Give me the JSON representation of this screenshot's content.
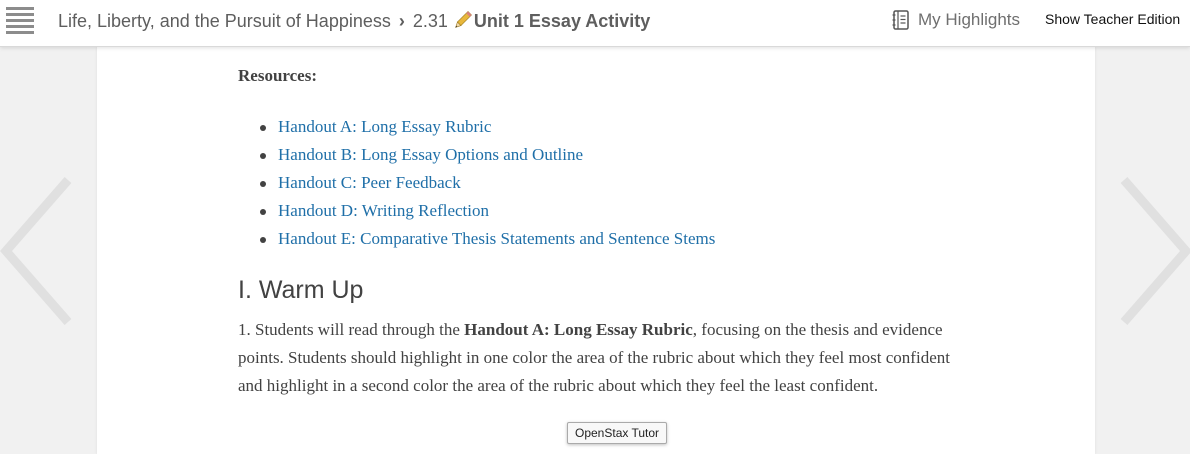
{
  "header": {
    "menu_icon": "hamburger-menu-icon",
    "book_title": "Life, Liberty, and the Pursuit of Happiness",
    "separator": "›",
    "section_number": "2.31",
    "page_icon": "pencil-icon",
    "page_title": "Unit 1 Essay Activity",
    "highlights_icon": "notebook-icon",
    "highlights_label": "My Highlights",
    "teacher_edition_label": "Show Teacher Edition"
  },
  "navigation": {
    "prev_icon": "chevron-left-icon",
    "next_icon": "chevron-right-icon"
  },
  "content": {
    "resources_label": "Resources:",
    "resources": [
      "Handout A: Long Essay Rubric",
      "Handout B: Long Essay Options and Outline",
      "Handout C: Peer Feedback",
      "Handout D: Writing Reflection",
      "Handout E: Comparative Thesis Statements and Sentence Stems"
    ],
    "section_heading": "I. Warm Up",
    "paragraph": {
      "before": "1. Students will read through the ",
      "bold": "Handout A: Long Essay Rubric",
      "after": ", focusing on the thesis and evidence points. Students should highlight in one color the area of the rubric about which they feel most confident and highlight in a second color the area of the rubric about which they feel the least confident."
    }
  },
  "tooltip": {
    "text": "OpenStax Tutor"
  },
  "colors": {
    "link": "#1f6fa8",
    "background": "#f1f1f1",
    "page": "#ffffff",
    "text": "#424242",
    "pencil": "#e8b73c"
  }
}
